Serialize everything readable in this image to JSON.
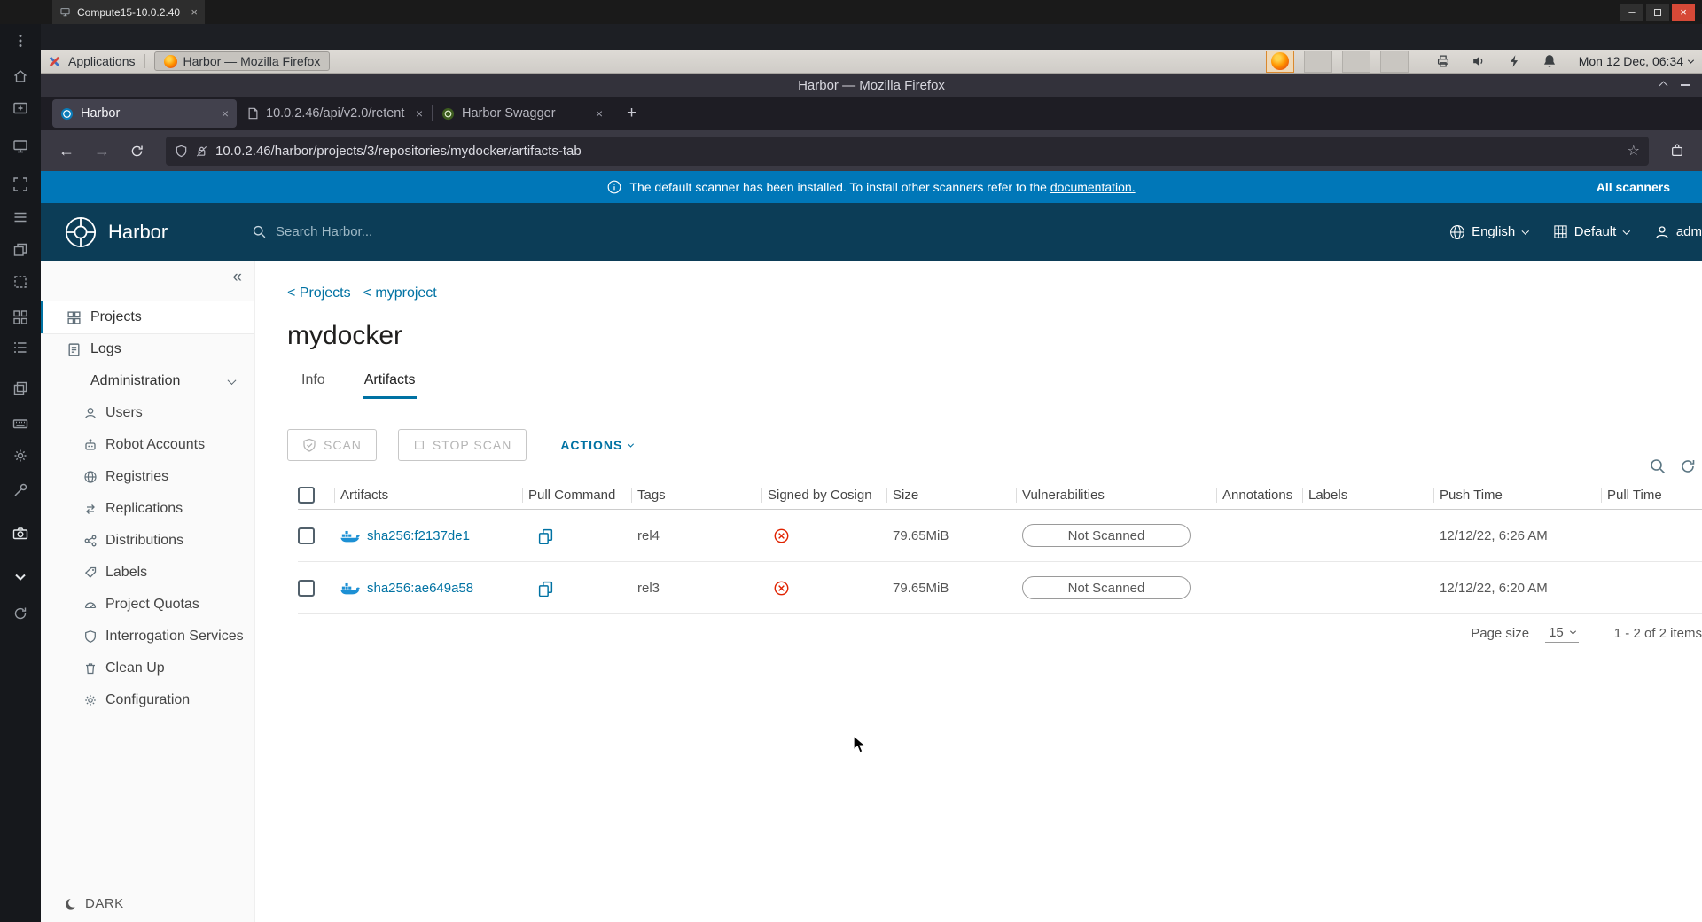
{
  "desktop": {
    "remote_tab": "Compute15-10.0.2.40",
    "applications": "Applications",
    "taskbar_window": "Harbor — Mozilla Firefox",
    "clock": "Mon 12 Dec, 06:34",
    "side_toolbar_icons": [
      "kebab-menu",
      "home",
      "new-window",
      "monitor",
      "fullscreen",
      "menu-lines",
      "window-restore",
      "selection",
      "grid",
      "list",
      "clone-panel",
      "keyboard",
      "settings",
      "tools",
      "camera",
      "chevron-down",
      "sync"
    ]
  },
  "firefox": {
    "window_title": "Harbor — Mozilla Firefox",
    "tabs": [
      {
        "label": "Harbor"
      },
      {
        "label": "10.0.2.46/api/v2.0/retent"
      },
      {
        "label": "Harbor Swagger"
      }
    ],
    "url": "10.0.2.46/harbor/projects/3/repositories/mydocker/artifacts-tab"
  },
  "banner": {
    "message": "The default scanner has been installed. To install other scanners refer to the",
    "link": "documentation.",
    "right_link": "All scanners"
  },
  "app_header": {
    "brand": "Harbor",
    "search_placeholder": "Search Harbor...",
    "language": "English",
    "registry": "Default",
    "user": "adm"
  },
  "sidebar": {
    "items": [
      {
        "label": "Projects"
      },
      {
        "label": "Logs"
      },
      {
        "label": "Administration"
      }
    ],
    "admin_items": [
      {
        "label": "Users"
      },
      {
        "label": "Robot Accounts"
      },
      {
        "label": "Registries"
      },
      {
        "label": "Replications"
      },
      {
        "label": "Distributions"
      },
      {
        "label": "Labels"
      },
      {
        "label": "Project Quotas"
      },
      {
        "label": "Interrogation Services"
      },
      {
        "label": "Clean Up"
      },
      {
        "label": "Configuration"
      }
    ],
    "dark_toggle": "DARK"
  },
  "main": {
    "breadcrumbs": [
      {
        "label": "< Projects"
      },
      {
        "label": "< myproject"
      }
    ],
    "title": "mydocker",
    "tabs": [
      {
        "label": "Info"
      },
      {
        "label": "Artifacts"
      }
    ],
    "toolbar": {
      "scan": "SCAN",
      "stop_scan": "STOP SCAN",
      "actions": "ACTIONS"
    },
    "table": {
      "columns": [
        "Artifacts",
        "Pull Command",
        "Tags",
        "Signed by Cosign",
        "Size",
        "Vulnerabilities",
        "Annotations",
        "Labels",
        "Push Time",
        "Pull Time"
      ],
      "rows": [
        {
          "artifact": "sha256:f2137de1",
          "tag": "rel4",
          "signed": "not-signed",
          "size": "79.65MiB",
          "vulnerability": "Not Scanned",
          "push_time": "12/12/22, 6:26 AM",
          "pull_time": ""
        },
        {
          "artifact": "sha256:ae649a58",
          "tag": "rel3",
          "signed": "not-signed",
          "size": "79.65MiB",
          "vulnerability": "Not Scanned",
          "push_time": "12/12/22, 6:20 AM",
          "pull_time": ""
        }
      ]
    },
    "pagination": {
      "page_size_label": "Page size",
      "page_size": "15",
      "range": "1 - 2 of 2 items"
    }
  },
  "colors": {
    "banner_blue": "#0077b8",
    "header_navy": "#0c3d57",
    "link_blue": "#0072a3",
    "danger_red": "#e02200",
    "docker_blue": "#1d90d4"
  }
}
